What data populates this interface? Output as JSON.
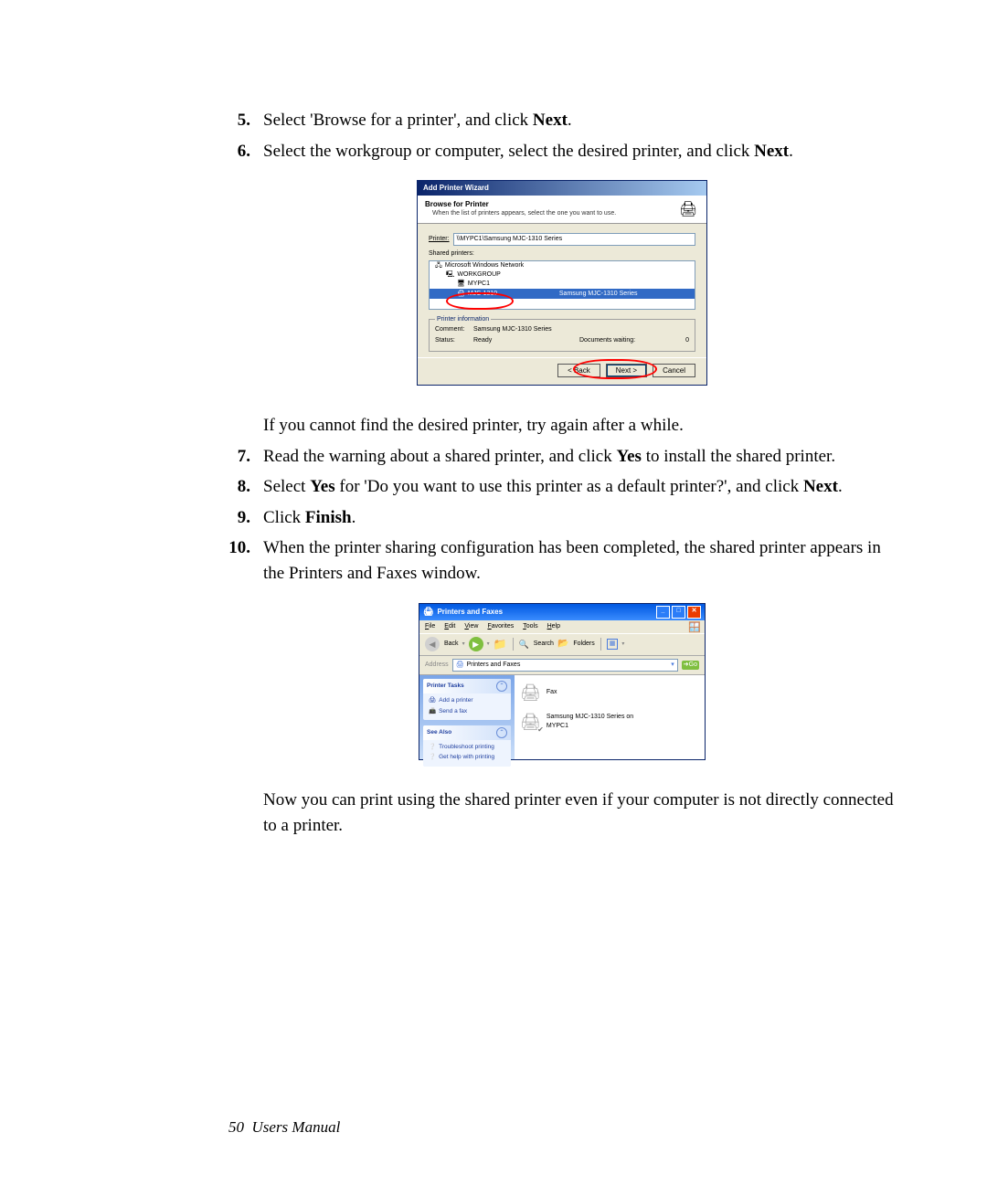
{
  "steps": {
    "n5": "5.",
    "t5_a": "Select 'Browse for a printer', and click ",
    "t5_b": "Next",
    "t5_c": ".",
    "n6": "6.",
    "t6_a": "Select the workgroup or computer, select the desired printer, and click ",
    "t6_b": "Next",
    "t6_c": ".",
    "after6": "If you cannot find the desired printer, try again after a while.",
    "n7": "7.",
    "t7_a": "Read the warning about a shared printer, and click ",
    "t7_b": "Yes",
    "t7_c": " to install the shared printer.",
    "n8": "8.",
    "t8_a": "Select ",
    "t8_b": "Yes",
    "t8_c": " for 'Do you want to use this printer as a default printer?', and click ",
    "t8_d": "Next",
    "t8_e": ".",
    "n9": "9.",
    "t9_a": "Click ",
    "t9_b": "Finish",
    "t9_c": ".",
    "n10": "10.",
    "t10": "When the printer sharing configuration has been completed, the shared printer appears in the Printers and Faxes window.",
    "closing": "Now you can print using the shared printer even if your computer is not directly connected to a printer."
  },
  "footer": {
    "page": "50",
    "label": "Users Manual"
  },
  "wizard": {
    "title": "Add Printer Wizard",
    "head1": "Browse for Printer",
    "head2": "When the list of printers appears, select the one you want to use.",
    "printer_lbl": "Printer:",
    "printer_val": "\\\\MYPC1\\Samsung MJC-1310 Series",
    "shared_lbl": "Shared printers:",
    "node1": "Microsoft Windows Network",
    "node2": "WORKGROUP",
    "node3": "MYPC1",
    "sel_left": "MJC-1310",
    "sel_right": "Samsung MJC-1310 Series",
    "info_legend": "Printer information",
    "info_comment_k": "Comment:",
    "info_comment_v": "Samsung MJC-1310 Series",
    "info_status_k": "Status:",
    "info_status_v": "Ready",
    "info_docs_k": "Documents waiting:",
    "info_docs_v": "0",
    "btn_back": "< Back",
    "btn_next": "Next >",
    "btn_cancel": "Cancel"
  },
  "pf": {
    "title": "Printers and Faxes",
    "menu": {
      "file": "File",
      "edit": "Edit",
      "view": "View",
      "fav": "Favorites",
      "tools": "Tools",
      "help": "Help"
    },
    "tool": {
      "back": "Back",
      "search": "Search",
      "folders": "Folders"
    },
    "addr_lbl": "Address",
    "addr_val": "Printers and Faxes",
    "go": "Go",
    "side1_title": "Printer Tasks",
    "side1_link1": "Add a printer",
    "side1_link2": "Send a fax",
    "side2_title": "See Also",
    "side2_link1": "Troubleshoot printing",
    "side2_link2": "Get help with printing",
    "item1": "Fax",
    "item2": "Samsung MJC-1310 Series on MYPC1"
  }
}
